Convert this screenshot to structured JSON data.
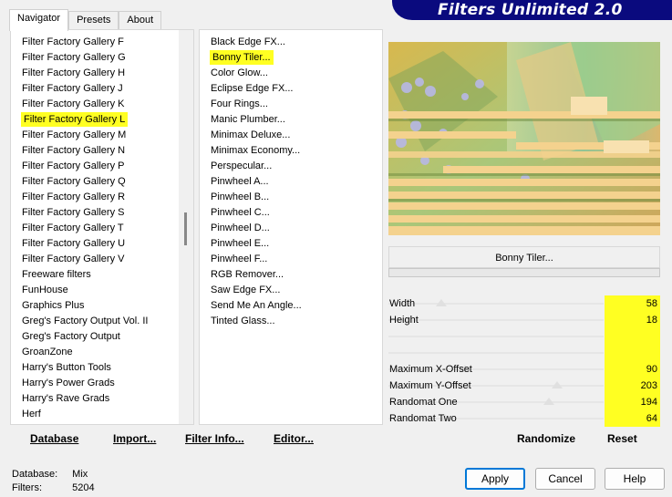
{
  "tabs": [
    {
      "label": "Navigator",
      "active": true
    },
    {
      "label": "Presets",
      "active": false
    },
    {
      "label": "About",
      "active": false
    }
  ],
  "banner": {
    "title": "Filters Unlimited 2.0"
  },
  "categories": {
    "items": [
      "Filter Factory Gallery F",
      "Filter Factory Gallery G",
      "Filter Factory Gallery H",
      "Filter Factory Gallery J",
      "Filter Factory Gallery K",
      "Filter Factory Gallery L",
      "Filter Factory Gallery M",
      "Filter Factory Gallery N",
      "Filter Factory Gallery P",
      "Filter Factory Gallery Q",
      "Filter Factory Gallery R",
      "Filter Factory Gallery S",
      "Filter Factory Gallery T",
      "Filter Factory Gallery U",
      "Filter Factory Gallery V",
      "Freeware filters",
      "FunHouse",
      "Graphics Plus",
      "Greg's Factory Output Vol. II",
      "Greg's Factory Output",
      "GroanZone",
      "Harry's Button Tools",
      "Harry's Power Grads",
      "Harry's Rave Grads",
      "Herf"
    ],
    "selected_index": 5,
    "highlight_color": "#ffff22"
  },
  "filters": {
    "items": [
      "Black Edge FX...",
      "Bonny Tiler...",
      "Color Glow...",
      "Eclipse Edge FX...",
      "Four Rings...",
      "Manic Plumber...",
      "Minimax Deluxe...",
      "Minimax Economy...",
      "Perspecular...",
      "Pinwheel A...",
      "Pinwheel B...",
      "Pinwheel C...",
      "Pinwheel D...",
      "Pinwheel E...",
      "Pinwheel F...",
      "RGB Remover...",
      "Saw Edge FX...",
      "Send Me An Angle...",
      "Tinted Glass..."
    ],
    "selected_index": 1
  },
  "preview": {
    "filter_name": "Bonny Tiler..."
  },
  "params": [
    {
      "label": "Width",
      "value": "58",
      "fraction": 0.23
    },
    {
      "label": "Height",
      "value": "18",
      "fraction": 0.07
    },
    {
      "label": "",
      "value": "",
      "fraction": null
    },
    {
      "label": "",
      "value": "",
      "fraction": null
    },
    {
      "label": "Maximum X-Offset",
      "value": "90",
      "fraction": 0.35
    },
    {
      "label": "Maximum Y-Offset",
      "value": "203",
      "fraction": 0.8
    },
    {
      "label": "Randomat One",
      "value": "194",
      "fraction": 0.76
    },
    {
      "label": "Randomat Two",
      "value": "64",
      "fraction": 0.25
    }
  ],
  "toolbar": {
    "database_label": "Database",
    "import_label": "Import...",
    "filter_info_label": "Filter Info...",
    "editor_label": "Editor...",
    "randomize_label": "Randomize",
    "reset_label": "Reset"
  },
  "info": {
    "database_label": "Database:",
    "database_value": "Mix",
    "filters_label": "Filters:",
    "filters_value": "5204"
  },
  "dialog": {
    "apply_label": "Apply",
    "cancel_label": "Cancel",
    "help_label": "Help"
  },
  "colors": {
    "banner_bg": "#0a0a7e",
    "highlight": "#ffff22",
    "accent_border": "#0078d7"
  }
}
